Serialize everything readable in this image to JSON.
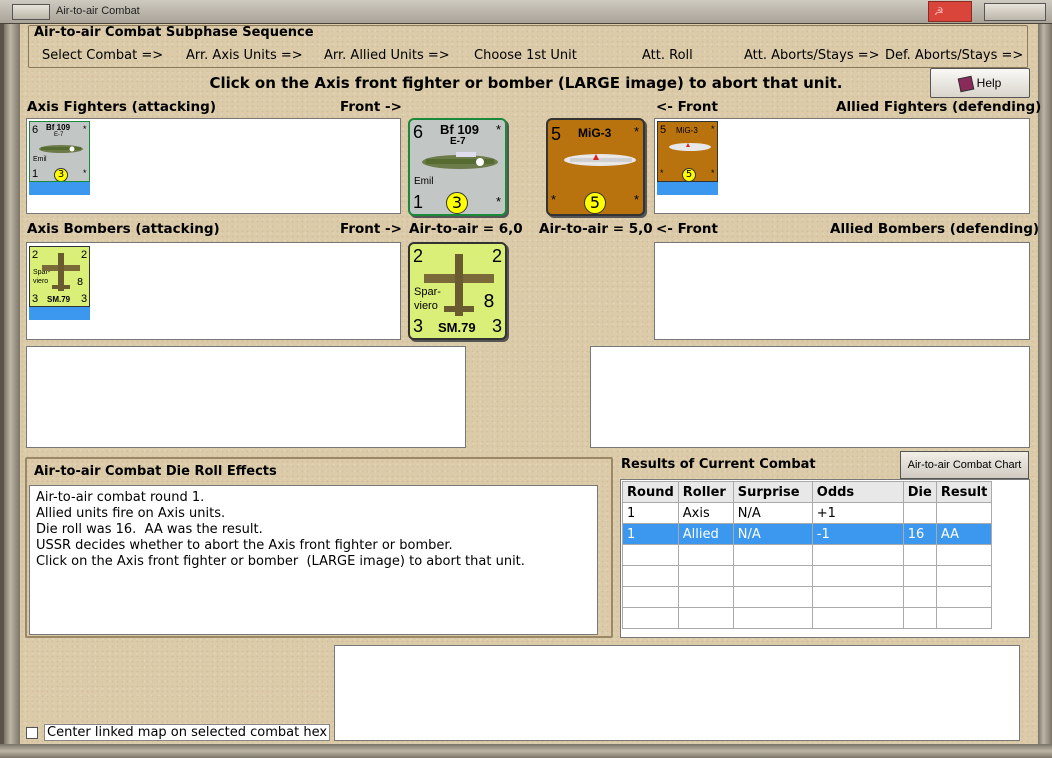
{
  "window": {
    "title": "Air-to-air Combat"
  },
  "sequence": {
    "title": "Air-to-air Combat Subphase Sequence",
    "steps": [
      "Select Combat =>",
      "Arr. Axis Units =>",
      "Arr. Allied Units =>",
      "Choose 1st Unit",
      "Att. Roll",
      "Att. Aborts/Stays =>",
      "Def. Aborts/Stays =>"
    ]
  },
  "instruction": "Click on the Axis front fighter or bomber  (LARGE image) to abort that unit.",
  "help_label": "Help",
  "labels": {
    "axis_fighters": "Axis Fighters (attacking)",
    "front_right": "Front ->",
    "front_left": "<- Front",
    "allied_fighters": "Allied Fighters (defending)",
    "axis_bombers": "Axis Bombers (attacking)",
    "allied_bombers": "Allied Bombers (defending)",
    "axis_air": "Air-to-air = 6,0",
    "allied_air": "Air-to-air = 5,0"
  },
  "units": {
    "bf109": {
      "top_left": "6",
      "name": "Bf 109",
      "model": "E-7",
      "nick": "Emil",
      "bottom_left": "1",
      "rating": "3",
      "star": "*"
    },
    "sm79": {
      "tl": "2",
      "tr": "2",
      "nick1": "Spar-",
      "nick2": "viero",
      "rating": "8",
      "bl": "3",
      "name": "SM.79",
      "br": "3"
    },
    "mig3": {
      "top_left": "5",
      "name": "MiG-3",
      "rating": "5",
      "star": "*"
    }
  },
  "effects": {
    "title": "Air-to-air Combat Die Roll Effects",
    "text": "Air-to-air combat round 1.\nAllied units fire on Axis units.\nDie roll was 16.  AA was the result.\nUSSR decides whether to abort the Axis front fighter or bomber.\nClick on the Axis front fighter or bomber  (LARGE image) to abort that unit."
  },
  "results": {
    "title": "Results of Current Combat",
    "chart_button": "Air-to-air Combat Chart",
    "columns": [
      "Round",
      "Roller",
      "Surprise",
      "Odds",
      "Die",
      "Result"
    ],
    "rows": [
      [
        "1",
        "Axis",
        "N/A",
        "+1",
        "",
        ""
      ],
      [
        "1",
        "Allied",
        "N/A",
        "-1",
        "16",
        "AA"
      ]
    ]
  },
  "center_label": "Center linked map on selected combat hex",
  "colors": {
    "brand_tan": "#dccba9",
    "selection_blue": "#3c98ef",
    "mig_brown": "#b8730f",
    "bomber_green": "#d9ef77",
    "fighter_gray": "#c2c6c4"
  }
}
